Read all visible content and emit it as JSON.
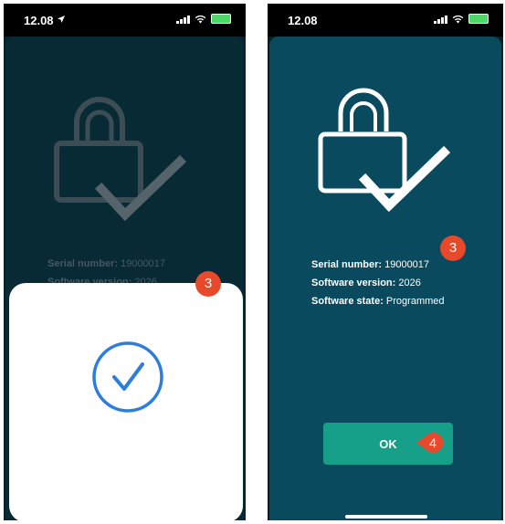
{
  "left_phone": {
    "status_time": "12.08",
    "serial_label": "Serial number:",
    "serial_value": "19000017",
    "software_label": "Software version:",
    "software_value": "2026",
    "badge": "3",
    "icons": [
      "location-arrow-icon",
      "signal-icon",
      "wifi-icon",
      "battery-charging-icon",
      "lock-check-icon",
      "check-circle-icon"
    ]
  },
  "right_phone": {
    "status_time": "12.08",
    "serial_label": "Serial number:",
    "serial_value": "19000017",
    "software_label": "Software version:",
    "software_value": "2026",
    "state_label": "Software state:",
    "state_value": "Programmed",
    "badge": "3",
    "ok_label": "OK",
    "ok_badge": "4",
    "icons": [
      "signal-icon",
      "wifi-icon",
      "battery-charging-icon",
      "lock-check-icon"
    ]
  },
  "colors": {
    "left_bg": "#072a35",
    "right_bg": "#094a5f",
    "badge": "#e8492a",
    "ok_button": "#16a08a",
    "check_circle": "#2c7ddc"
  }
}
